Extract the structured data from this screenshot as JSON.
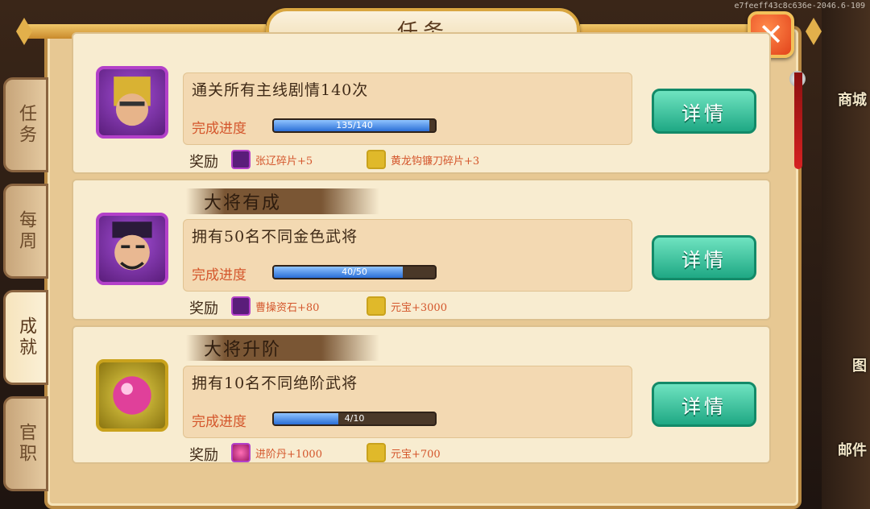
{
  "title": "任务",
  "close_label": "✕",
  "version": "e7feeff43c8c636e-2046.6-109",
  "side_labels": {
    "mall": "商城",
    "pic": "图",
    "mail": "邮件"
  },
  "tabs": [
    {
      "label": "任务",
      "active": false
    },
    {
      "label": "每周",
      "active": false
    },
    {
      "label": "成就",
      "active": true
    },
    {
      "label": "官职",
      "active": false
    }
  ],
  "tasks": [
    {
      "header": "",
      "avatar": "hero-gold-helmet",
      "description": "通关所有主线剧情140次",
      "progress_label": "完成进度",
      "progress_current": 135,
      "progress_total": 140,
      "progress_text": "135/140",
      "reward_title": "奖励",
      "rewards": [
        {
          "icon": "hero-fragment-icon",
          "text": "张辽碎片+5"
        },
        {
          "icon": "weapon-fragment-icon",
          "text": "黄龙钩镰刀碎片+3"
        }
      ],
      "button": "详情"
    },
    {
      "header": "大将有成",
      "avatar": "hero-caocao",
      "description": "拥有50名不同金色武将",
      "progress_label": "完成进度",
      "progress_current": 40,
      "progress_total": 50,
      "progress_text": "40/50",
      "reward_title": "奖励",
      "rewards": [
        {
          "icon": "hero-stone-icon",
          "text": "曹操资石+80"
        },
        {
          "icon": "ingot-icon",
          "text": "元宝+3000"
        }
      ],
      "button": "详情"
    },
    {
      "header": "大将升阶",
      "avatar": "pink-gem",
      "description": "拥有10名不同绝阶武将",
      "progress_label": "完成进度",
      "progress_current": 4,
      "progress_total": 10,
      "progress_text": "4/10",
      "reward_title": "奖励",
      "rewards": [
        {
          "icon": "advance-pill-icon",
          "text": "进阶丹+1000"
        },
        {
          "icon": "ingot-icon",
          "text": "元宝+700"
        }
      ],
      "button": "详情"
    }
  ]
}
